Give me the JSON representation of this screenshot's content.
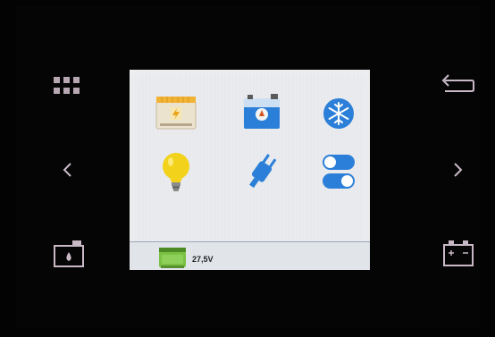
{
  "device": {
    "left_buttons": [
      {
        "icon": "grid-menu-icon"
      },
      {
        "icon": "chevron-left-icon"
      },
      {
        "icon": "tank-level-icon"
      }
    ],
    "right_buttons": [
      {
        "icon": "back-arrow-icon"
      },
      {
        "icon": "chevron-right-icon"
      },
      {
        "icon": "battery-icon"
      }
    ]
  },
  "screen": {
    "menu_tiles": [
      {
        "icon": "solar-charger-icon"
      },
      {
        "icon": "tank-sensor-icon"
      },
      {
        "icon": "snowflake-icon"
      },
      {
        "icon": "light-bulb-icon"
      },
      {
        "icon": "power-plug-icon"
      },
      {
        "icon": "toggle-switches-icon"
      }
    ],
    "status": {
      "icon": "battery-level-icon",
      "voltage": "27,5V"
    }
  },
  "colors": {
    "accent_blue": "#2c7fd8",
    "bulb_yellow": "#f2d21a",
    "battery_green": "#7ac143",
    "screen_bg": "#e9ebee"
  }
}
